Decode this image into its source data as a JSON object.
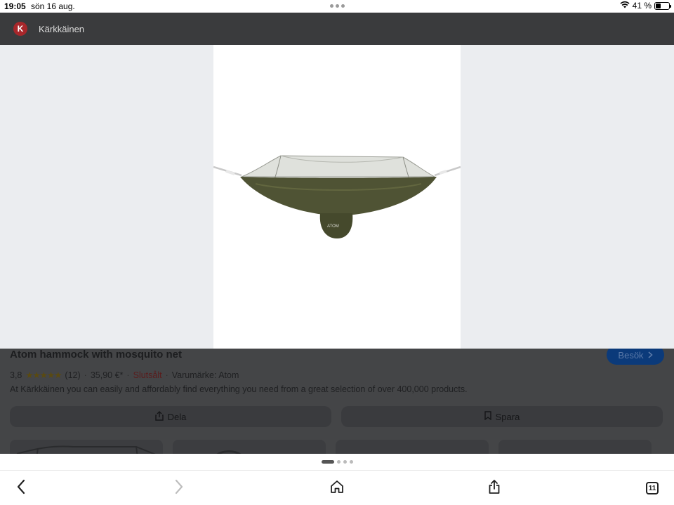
{
  "status_bar": {
    "time": "19:05",
    "date": "sön 16 aug.",
    "battery": "41 %",
    "battery_level": 0.41
  },
  "header": {
    "site_name": "Kärkkäinen",
    "logo_letter": "K"
  },
  "product": {
    "title": "Atom hammock with mosquito net",
    "visit_label": "Besök",
    "rating": "3,8",
    "rating_value": 3.8,
    "stars": "★★★★★",
    "review_count": "(12)",
    "price": "35,90 €*",
    "availability": "Slutsålt",
    "brand": "Varumärke: Atom",
    "description": "At Kärkkäinen you can easily and affordably find everything you need from a great selection of over 400,000 products.",
    "share_label": "Dela",
    "save_label": "Spara"
  },
  "page_indicator": {
    "count": 4,
    "active_index": 0
  },
  "toolbar": {
    "tab_count": "11",
    "icons": [
      "back-icon",
      "forward-icon",
      "home-icon",
      "share-icon",
      "tabs-icon"
    ]
  },
  "colors": {
    "header_bg": "#3a3b3d",
    "viewer_bg": "#ebedf0",
    "hammock": "#4f5334",
    "brand_red": "#a8272b",
    "visit_blue": "#0b3a7a"
  }
}
